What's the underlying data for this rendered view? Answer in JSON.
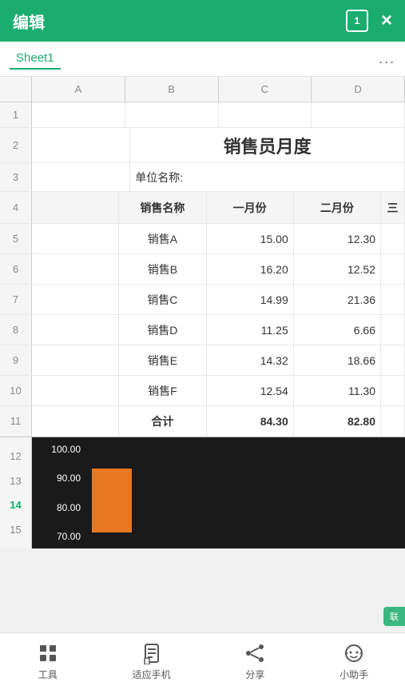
{
  "titleBar": {
    "title": "编辑",
    "boxNum": "1",
    "closeIcon": "×"
  },
  "tabs": {
    "sheet1": "Sheet1",
    "more": "..."
  },
  "columns": [
    "A",
    "B",
    "C",
    "D"
  ],
  "rows": [
    {
      "num": 1,
      "cells": [
        "",
        "",
        "",
        ""
      ]
    },
    {
      "num": 2,
      "cells": [
        "",
        "",
        "销售员月度",
        "",
        ""
      ]
    },
    {
      "num": 3,
      "cells": [
        "",
        "单位名称:",
        "",
        ""
      ]
    },
    {
      "num": 4,
      "cells": [
        "",
        "销售名称",
        "一月份",
        "二月份",
        "三"
      ]
    },
    {
      "num": 5,
      "cells": [
        "",
        "销售A",
        "15.00",
        "12.30",
        ""
      ]
    },
    {
      "num": 6,
      "cells": [
        "",
        "销售B",
        "16.20",
        "12.52",
        ""
      ]
    },
    {
      "num": 7,
      "cells": [
        "",
        "销售C",
        "14.99",
        "21.36",
        ""
      ]
    },
    {
      "num": 8,
      "cells": [
        "",
        "销售D",
        "11.25",
        "6.66",
        ""
      ]
    },
    {
      "num": 9,
      "cells": [
        "",
        "销售E",
        "14.32",
        "18.66",
        ""
      ]
    },
    {
      "num": 10,
      "cells": [
        "",
        "销售F",
        "12.54",
        "11.30",
        ""
      ]
    },
    {
      "num": 11,
      "cells": [
        "",
        "合计",
        "84.30",
        "82.80",
        ""
      ]
    }
  ],
  "chart": {
    "yLabels": [
      "100.00",
      "90.00",
      "80.00",
      "70.00"
    ],
    "barHeight": 80,
    "activeRow": 14
  },
  "bottomNav": [
    {
      "id": "tools",
      "label": "工具",
      "icon": "grid"
    },
    {
      "id": "fit",
      "label": "适应手机",
      "icon": "doc"
    },
    {
      "id": "share",
      "label": "分享",
      "icon": "share"
    },
    {
      "id": "assistant",
      "label": "小助手",
      "icon": "face"
    }
  ],
  "watermark": "联"
}
